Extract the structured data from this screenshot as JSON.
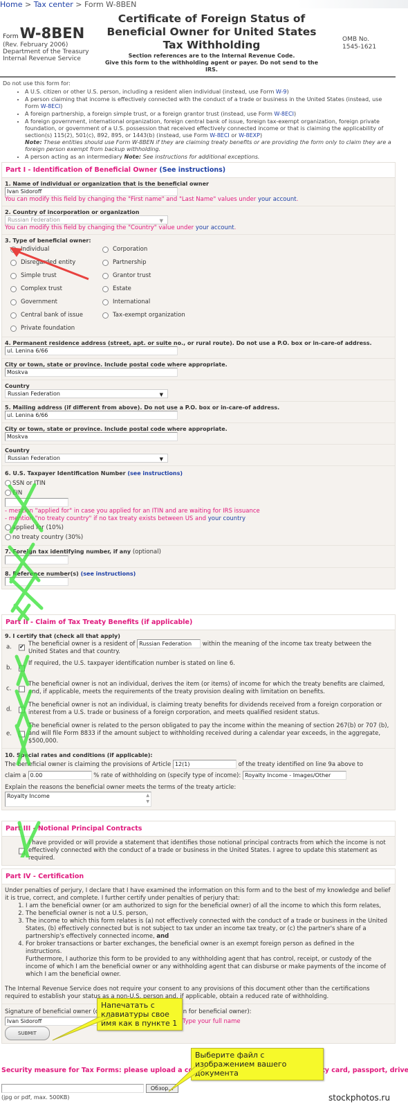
{
  "breadcrumb": {
    "home": "Home",
    "sep": " > ",
    "tax_center": "Tax center",
    "current": "Form W-8BEN"
  },
  "header": {
    "form_word": "Form",
    "form_number": "W-8BEN",
    "revision": "(Rev. February 2006)",
    "department": "Department of the Treasury",
    "agency": "Internal Revenue Service",
    "title": "Certificate of Foreign Status of Beneficial Owner for United States Tax Withholding",
    "subtitle_1": "Section references are to the Internal Revenue Code.",
    "subtitle_2": "Give this form to the withholding agent or payer. Do not send to the IRS.",
    "omb_label": "OMB No.",
    "omb_number": "1545-1621"
  },
  "do_not_use": {
    "intro": "Do not use this form for:",
    "items": [
      {
        "text": "A U.S. citizen or other U.S. person, including a resident alien individual (instead, use Form ",
        "link": "W-9",
        "after": ")"
      },
      {
        "text": "A person claiming that income is effectively connected with the conduct of a trade or business in the United States (instead, use Form ",
        "link": "W-8ECI",
        "after": ")"
      },
      {
        "text": "A foreign partnership, a foreign simple trust, or a foreign grantor trust (instead, use Form ",
        "link": "W-8ECI",
        "after": ")"
      },
      {
        "text": "A foreign government, international organization, foreign central bank of issue, foreign tax-exempt organization, foreign private foundation, or government of a U.S. possession that received effectively connected income or that is claiming the applicability of section(s) 115(2), 501(c), 892, 895, or 1443(b) (instead, use Form ",
        "link": "W-8ECI",
        "mid": " or ",
        "link2": "W-8EXP",
        "after": ")",
        "note_label": "Note:",
        "note": " These entities should use Form W-8BEN if they are claiming treaty benefits or are providing the form only to claim they are a foreign person exempt from backup withholding."
      },
      {
        "text": "A person acting as an intermediary ",
        "note_label": "Note:",
        "note": " See instructions for additional exceptions."
      }
    ]
  },
  "part1": {
    "title": "Part I - Identification of Beneficial Owner",
    "see_instructions": "(See instructions)",
    "q1_label": "1. Name of individual or organization that is the beneficial owner",
    "q1_value": "Ivan Sidoroff",
    "q1_hint": "You can modify this field by changing the \"First name\" and \"Last Name\" values under ",
    "q1_hint_link": "your account",
    "q1_hint_end": ".",
    "q2_label": "2. Country of incorporation or organization",
    "q2_value": "Russian Federation",
    "q2_hint": "You can modify this field by changing the \"Country\" value under ",
    "q2_hint_link": "your account",
    "q2_hint_end": ".",
    "q3_label": "3. Type of beneficial owner:",
    "q3_options": [
      {
        "label": "Individual",
        "selected": true
      },
      {
        "label": "Disregarded entity",
        "selected": false
      },
      {
        "label": "Simple trust",
        "selected": false
      },
      {
        "label": "Complex trust",
        "selected": false
      },
      {
        "label": "Government",
        "selected": false
      },
      {
        "label": "Central bank of issue",
        "selected": false
      },
      {
        "label": "Private foundation",
        "selected": false
      },
      {
        "label": "Corporation",
        "selected": false
      },
      {
        "label": "Partnership",
        "selected": false
      },
      {
        "label": "Grantor trust",
        "selected": false
      },
      {
        "label": "Estate",
        "selected": false
      },
      {
        "label": "International",
        "selected": false
      },
      {
        "label": "Tax-exempt organization",
        "selected": false
      }
    ],
    "q4_label": "4. Permanent residence address (street, apt. or suite no., or rural route). Do not use a P.O. box or in-care-of address.",
    "q4_value": "ul. Lenina 6/66",
    "q4_city_label": "City or town, state or province. Include postal code where appropriate.",
    "q4_city_value": "Moskva",
    "q4_country_label": "Country",
    "q4_country_value": "Russian Federation",
    "q5_label": "5. Mailing address (if different from above). Do not use a P.O. box or in-care-of address.",
    "q5_value": "ul. Lenina 6/66",
    "q5_city_label": "City or town, state or province. Include postal code where appropriate.",
    "q5_city_value": "Moskva",
    "q5_country_label": "Country",
    "q5_country_value": "Russian Federation",
    "q6_label": "6. U.S. Taxpayer Identification Number",
    "q6_link": "(see instructions)",
    "q6_opt1": "SSN or ITIN",
    "q6_opt2": "EIN",
    "q6_value": "",
    "q6_note1": "- mention \"applied for\" in case you applied for an ITIN and are waiting for IRS issuance",
    "q6_note2": "- mention \"no treaty country\" if no tax treaty exists between US and ",
    "q6_note2_link": "your country",
    "q6_opt3": "applied for (10%)",
    "q6_opt4": "no treaty country (30%)",
    "q7_label": "7. Foreign tax identifying number, if any",
    "q7_optional": "(optional)",
    "q7_value": "",
    "q8_label": "8. Reference number(s)",
    "q8_link": "(see instructions)",
    "q8_value": ""
  },
  "part2": {
    "title": "Part II - Claim of Tax Treaty Benefits (if applicable)",
    "q9_label": "9. I certify that (check all that apply)",
    "items": [
      {
        "letter": "a.",
        "checked": true,
        "text_before": "The beneficial owner is a resident of ",
        "input": "Russian Federation",
        "text_after": " within the meaning of the income tax treaty between the United States and that country."
      },
      {
        "letter": "b.",
        "checked": false,
        "text_before": "If required, the U.S. taxpayer identification number is stated on line 6."
      },
      {
        "letter": "c.",
        "checked": false,
        "text_before": "The beneficial owner is not an individual, derives the item (or items) of income for which the treaty benefits are claimed, and, if applicable, meets the requirements of the treaty provision dealing with limitation on benefits."
      },
      {
        "letter": "d.",
        "checked": false,
        "text_before": "The beneficial owner is not an individual, is claiming treaty benefits for dividends received from a foreign corporation or interest from a U.S. trade or business of a foreign corporation, and meets qualified resident status."
      },
      {
        "letter": "e.",
        "checked": false,
        "text_before": "The beneficial owner is related to the person obligated to pay the income within the meaning of section 267(b) or 707 (b), and will file Form 8833 if the amount subject to withholding received during a calendar year exceeds, in the aggregate, $500,000."
      }
    ],
    "q10_label": "10. Special rates and conditions (if applicable):",
    "q10_text1": "The beneficial owner is claiming the provisions of Article ",
    "q10_article": "12(1)",
    "q10_text2": " of the treaty identified on line 9a above to",
    "q10_text3": "claim a ",
    "q10_rate": "0.00",
    "q10_text4": " % rate of withholding on (specify type of income): ",
    "q10_income": "Royalty Income - Images/Other",
    "q10_explain_label": "Explain the reasons the beneficial owner meets the terms of the treaty article:",
    "q10_explain_value": "Royalty Income"
  },
  "part3": {
    "title": "Part III - Notional Principal Contracts",
    "checked": false,
    "text": "I have provided or will provide a statement that identifies those notional principal contracts from which the income is not effectively connected with the conduct of a trade or business in the United States. I agree to update this statement as required."
  },
  "part4": {
    "title": "Part IV - Certification",
    "intro": "Under penalties of perjury, I declare that I have examined the information on this form and to the best of my knowledge and belief it is true, correct, and complete. I further certify under penalties of perjury that:",
    "items": [
      "I am the beneficial owner (or am authorized to sign for the beneficial owner) of all the income to which this form relates,",
      "The beneficial owner is not a U.S. person,",
      "The income to which this form relates is (a) not effectively connected with the conduct of a trade or business in the United States, (b) effectively connected but is not subject to tax under an income tax treaty, or (c) the partner's share of a partnership's effectively connected income,",
      "For broker transactions or barter exchanges, the beneficial owner is an exempt foreign person as defined in the instructions."
    ],
    "item3_bold": "and",
    "furthermore": "Furthermore, I authorize this form to be provided to any withholding agent that has control, receipt, or custody of the income of which I am the beneficial owner or any withholding agent that can disburse or make payments of the income of which I am the beneficial owner.",
    "irs_note": "The Internal Revenue Service does not require your consent to any provisions of this document other than the certifications required to establish your status as a non-U.S. person and, if applicable, obtain a reduced rate of withholding.",
    "signature_label": "Signature of beneficial owner (or individual authorized to sign for beneficial owner):",
    "signature_value": "Ivan Sidoroff",
    "signature_hint": "Type your full name",
    "submit_label": "SUBMIT"
  },
  "security": {
    "text": "Security measure for Tax Forms: please upload a copy of your photo ID (such us identity card, passport, driver'",
    "file_value": "",
    "browse_label": "Обзор...",
    "file_hint": "(jpg or pdf, max. 500KB)"
  },
  "annotations": {
    "callout_name": "Напечатать с клавиатуры свое имя как в пункте 1",
    "callout_file": "Выберите файл с изображением вашего документа",
    "watermark": "stockphotos.ru",
    "arrow_color": "#e8423f",
    "x_color": "#3fe43f",
    "callout_color": "#f6f92a"
  }
}
